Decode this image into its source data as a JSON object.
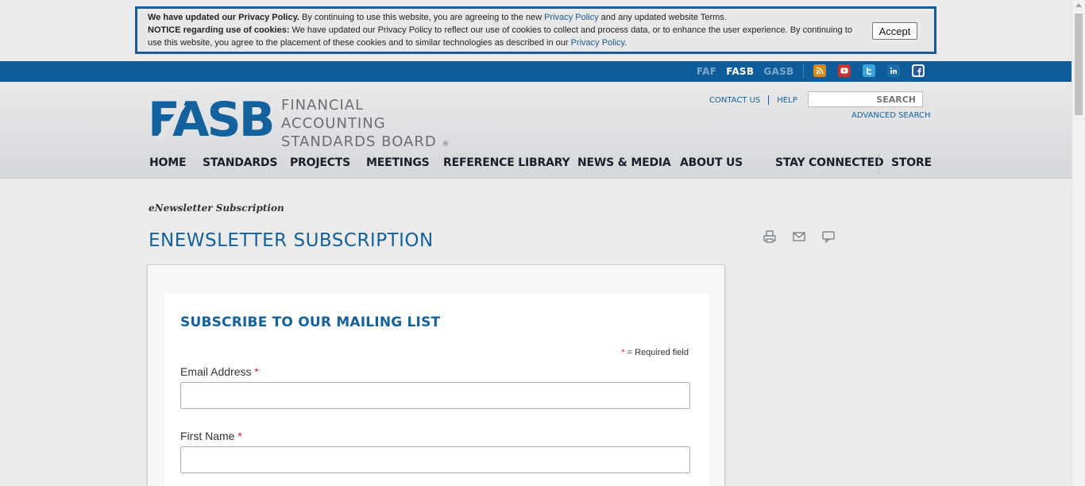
{
  "cookie": {
    "line1_bold": "We have updated our Privacy Policy.",
    "line1_text": " By continuing to use this website, you are agreeing to the new ",
    "line1_link": "Privacy Policy",
    "line1_end": " and any updated website Terms.",
    "line2_bold": "NOTICE regarding use of cookies:",
    "line2_text": " We have updated our Privacy Policy to reflect our use of cookies to collect and process data, or to enhance the user experience. By continuing to use this website, you agree to the placement of these cookies and to similar technologies as described in our ",
    "line2_link": "Privacy Policy",
    "line2_end": ".",
    "accept_label": "Accept"
  },
  "topbar": {
    "sites": [
      "FAF",
      "FASB",
      "GASB"
    ],
    "active_site": "FASB",
    "social_icons": [
      "rss-icon",
      "youtube-icon",
      "twitter-icon",
      "linkedin-icon",
      "facebook-icon"
    ]
  },
  "header": {
    "logo_word": "FASB",
    "logo_line1": "FINANCIAL",
    "logo_line2": "ACCOUNTING",
    "logo_line3": "STANDARDS BOARD",
    "logo_reg": "®",
    "contact_us": "CONTACT US",
    "help": "HELP",
    "search_placeholder": "SEARCH",
    "advanced_search": "ADVANCED SEARCH"
  },
  "nav": {
    "items": [
      "HOME",
      "STANDARDS",
      "PROJECTS",
      "MEETINGS",
      "REFERENCE LIBRARY",
      "NEWS & MEDIA",
      "ABOUT US",
      "STAY CONNECTED",
      "STORE"
    ]
  },
  "content": {
    "breadcrumb": "eNewsletter Subscription",
    "page_title": "ENEWSLETTER SUBSCRIPTION",
    "tools": [
      "print-icon",
      "email-icon",
      "comment-icon"
    ]
  },
  "form": {
    "title": "SUBSCRIBE TO OUR MAILING LIST",
    "required_star": "*",
    "required_note": " = Required field",
    "email_label": "Email Address",
    "email_value": "",
    "first_name_label": "First Name",
    "first_name_value": ""
  },
  "colors": {
    "brand_blue": "#13629e",
    "topbar_blue": "#0f5c9b",
    "required_red": "#dd2222"
  }
}
